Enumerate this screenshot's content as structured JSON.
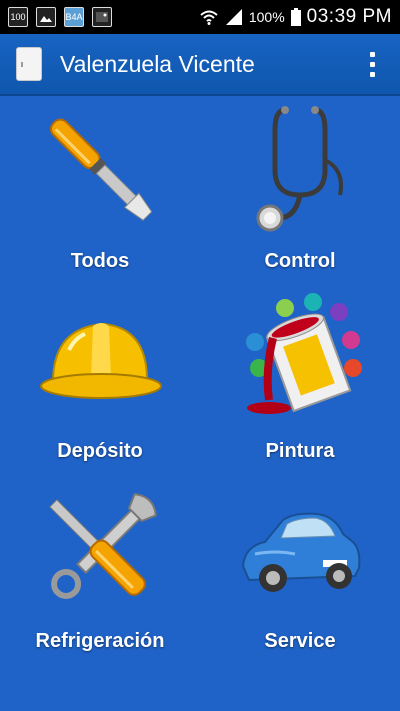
{
  "status_bar": {
    "notif_icons": [
      "battery-100-icon",
      "image-icon",
      "b4a-icon",
      "photo-icon"
    ],
    "badge_100": "100",
    "badge_b4a": "B4A",
    "battery_percent": "100%",
    "time": "03:39 PM"
  },
  "app_bar": {
    "title": "Valenzuela Vicente"
  },
  "tiles": [
    {
      "label": "Todos",
      "icon": "screwdriver-icon"
    },
    {
      "label": "Control",
      "icon": "stethoscope-icon"
    },
    {
      "label": "Depósito",
      "icon": "hard-hat-icon"
    },
    {
      "label": "Pintura",
      "icon": "paint-can-icon"
    },
    {
      "label": "Refrigeración",
      "icon": "tools-icon"
    },
    {
      "label": "Service",
      "icon": "car-icon"
    }
  ],
  "colors": {
    "background": "#1f63c9",
    "app_bar": "#1864c2"
  }
}
